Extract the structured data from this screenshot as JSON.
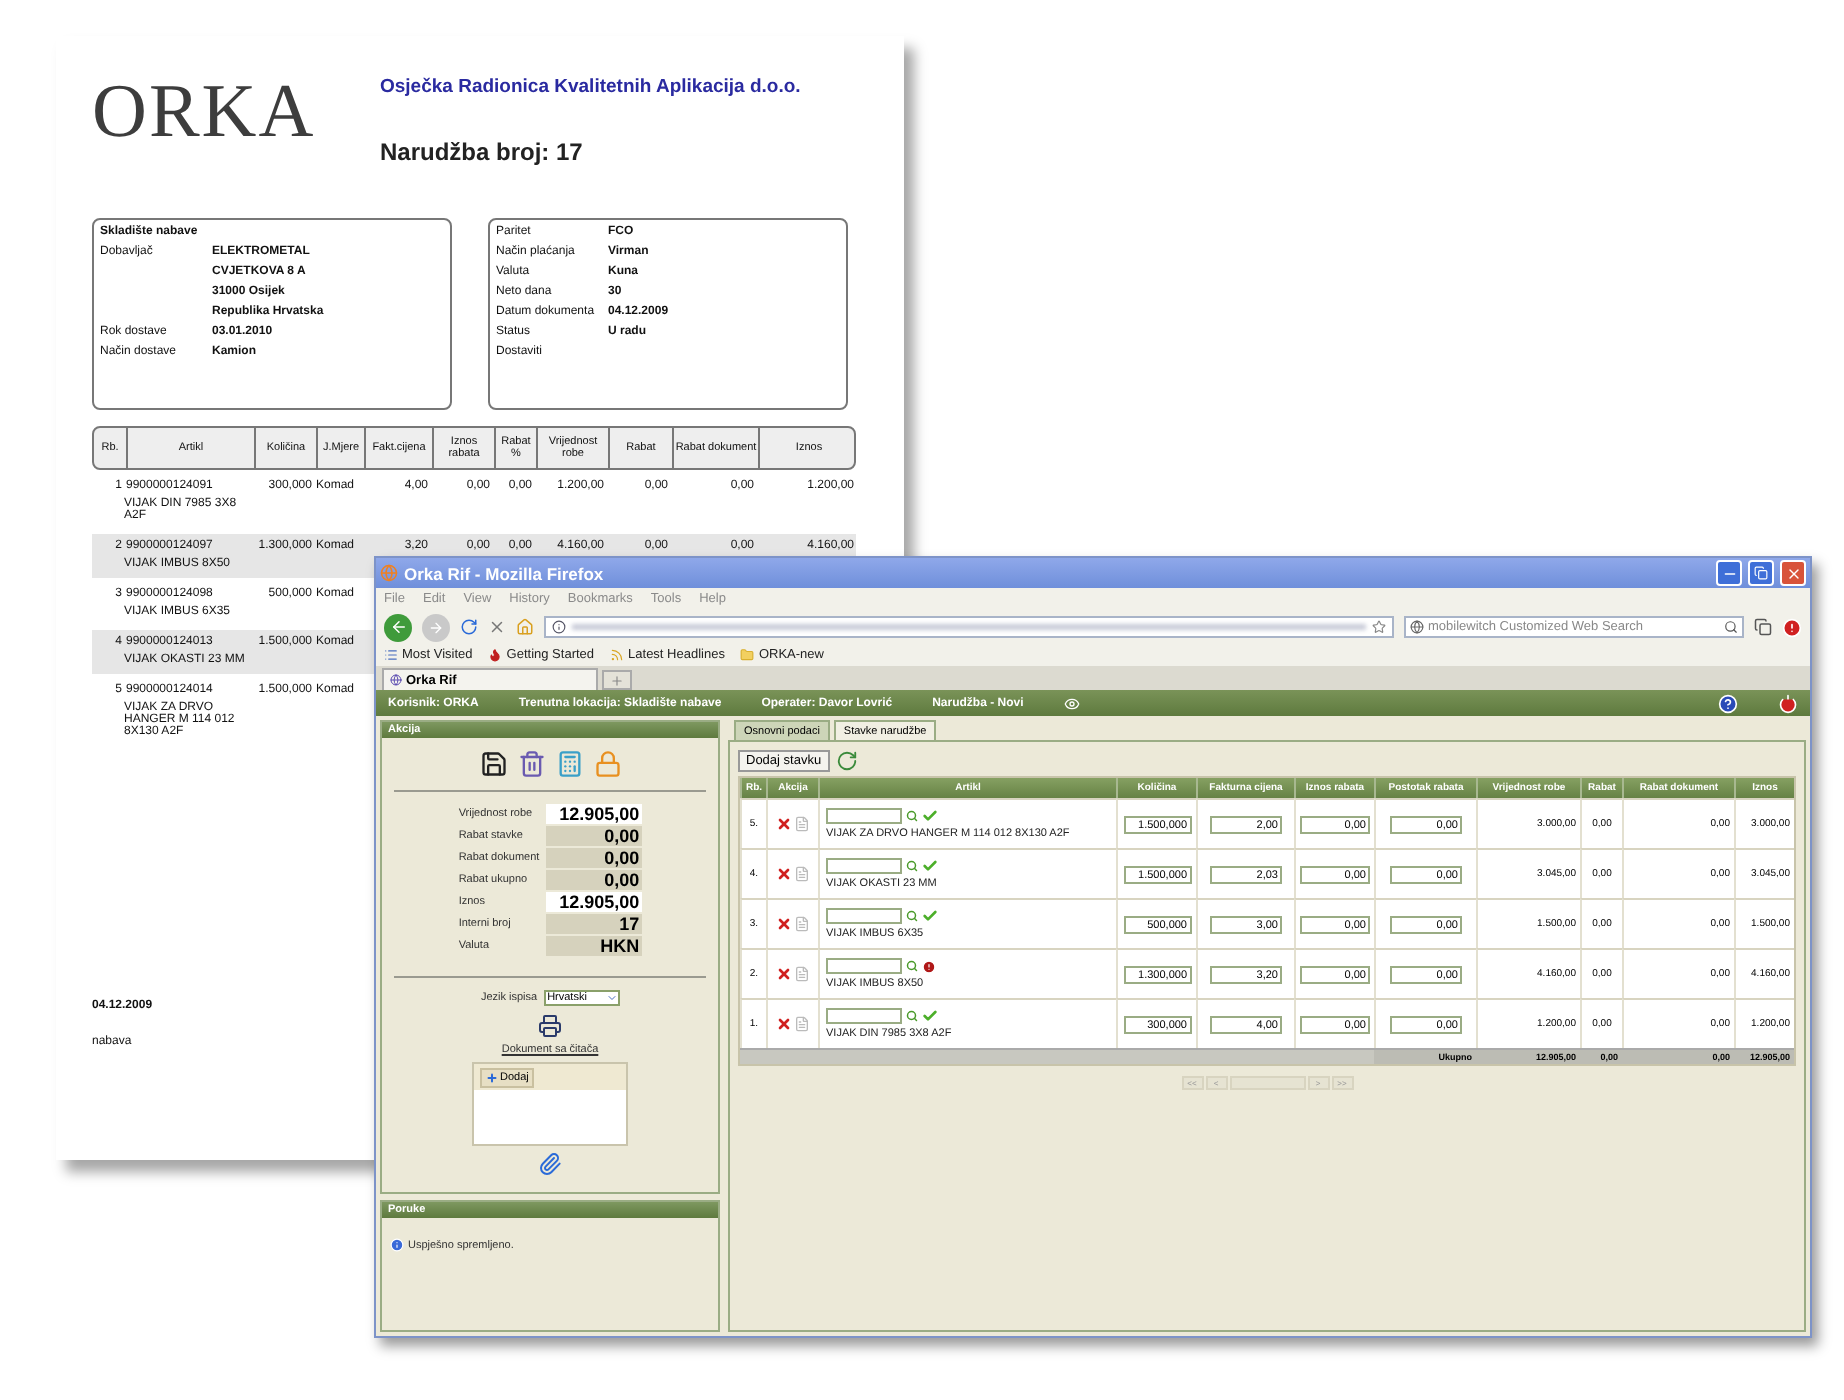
{
  "document": {
    "logo": "ORKA",
    "company": "Osječka Radionica Kvalitetnih Aplikacija d.o.o.",
    "title": "Narudžba broj: 17",
    "left_box": {
      "heading": "Skladište nabave",
      "fields": [
        {
          "label": "Dobavljač",
          "lines": [
            "ELEKTROMETAL",
            "CVJETKOVA 8 A",
            "31000 Osijek",
            "Republika Hrvatska"
          ]
        },
        {
          "label": "Rok dostave",
          "lines": [
            "03.01.2010"
          ]
        },
        {
          "label": "Način dostave",
          "lines": [
            "Kamion"
          ]
        }
      ]
    },
    "right_box": {
      "fields": [
        {
          "label": "Paritet",
          "lines": [
            "FCO"
          ]
        },
        {
          "label": "Način plaćanja",
          "lines": [
            "Virman"
          ]
        },
        {
          "label": "Valuta",
          "lines": [
            "Kuna"
          ]
        },
        {
          "label": "Neto dana",
          "lines": [
            "30"
          ]
        },
        {
          "label": "Datum dokumenta",
          "lines": [
            "04.12.2009"
          ]
        },
        {
          "label": "Status",
          "lines": [
            "U radu"
          ]
        },
        {
          "label": "Dostaviti"
        }
      ]
    },
    "table": {
      "columns": [
        "Rb.",
        "Artikl",
        "Količina",
        "J.Mjere",
        "Fakt.cijena",
        "Iznos rabata",
        "Rabat %",
        "Vrijednost robe",
        "Rabat",
        "Rabat dokument",
        "Iznos"
      ],
      "rows": [
        {
          "shaded": false,
          "name": "VIJAK DIN 7985 3X8 A2F",
          "cells": [
            "1",
            "9900000124091",
            "300,000",
            "Komad",
            "4,00",
            "0,00",
            "0,00",
            "1.200,00",
            "0,00",
            "0,00",
            "1.200,00"
          ]
        },
        {
          "shaded": true,
          "name": "VIJAK IMBUS 8X50",
          "cells": [
            "2",
            "9900000124097",
            "1.300,000",
            "Komad",
            "3,20",
            "0,00",
            "0,00",
            "4.160,00",
            "0,00",
            "0,00",
            "4.160,00"
          ]
        },
        {
          "shaded": false,
          "name": "VIJAK IMBUS 6X35",
          "cells": [
            "3",
            "9900000124098",
            "500,000",
            "Komad"
          ]
        },
        {
          "shaded": true,
          "name": "VIJAK OKASTI 23 MM",
          "cells": [
            "4",
            "9900000124013",
            "1.500,000",
            "Komad"
          ]
        },
        {
          "shaded": false,
          "name": "VIJAK ZA DRVO HANGER M 114 012 8X130 A2F",
          "cells": [
            "5",
            "9900000124014",
            "1.500,000",
            "Komad"
          ]
        }
      ]
    },
    "footer": [
      "04.12.2009",
      "nabava"
    ]
  },
  "window": {
    "title": "Orka Rif - Mozilla Firefox"
  },
  "menu": [
    "File",
    "Edit",
    "View",
    "History",
    "Bookmarks",
    "Tools",
    "Help"
  ],
  "search": {
    "placeholder": "mobilewitch Customized Web Search"
  },
  "bookmarks": [
    {
      "label": "Most Visited",
      "kind": "list"
    },
    {
      "label": "Getting Started",
      "kind": "flame"
    },
    {
      "label": "Latest Headlines",
      "kind": "feed"
    },
    {
      "label": "ORKA-new",
      "kind": "folder"
    }
  ],
  "tabs": [
    {
      "label": "Orka Rif",
      "selected": true
    }
  ],
  "app_bar": [
    "Korisnik: ORKA",
    "Trenutna lokacija: Skladište nabave",
    "Operater: Davor Lovrić",
    "Narudžba - Novi"
  ],
  "akcija": {
    "title": "Akcija",
    "summary": [
      {
        "label": "Vrijednost robe",
        "value": "12.905,00",
        "boxed": false
      },
      {
        "label": "Rabat stavke",
        "value": "0,00",
        "boxed": true
      },
      {
        "label": "Rabat dokument",
        "value": "0,00",
        "boxed": true
      },
      {
        "label": "Rabat ukupno",
        "value": "0,00",
        "boxed": true
      },
      {
        "label": "Iznos",
        "value": "12.905,00",
        "boxed": false
      },
      {
        "label": "Interni broj",
        "value": "17",
        "boxed": true
      },
      {
        "label": "Valuta",
        "value": "HKN",
        "boxed": true
      }
    ],
    "language": {
      "label": "Jezik ispisa",
      "value": "Hrvatski"
    },
    "reader": {
      "title": "Dokument sa čitača",
      "button": "Dodaj"
    }
  },
  "poruke": {
    "title": "Poruke",
    "message": "Uspješno spremljeno."
  },
  "order_tabs": [
    {
      "label": "Osnovni podaci",
      "selected": false
    },
    {
      "label": "Stavke narudžbe",
      "selected": true
    }
  ],
  "add_button": "Dodaj stavku",
  "items_table": {
    "columns": [
      "Rb.",
      "Akcija",
      "Artikl",
      "Količina",
      "Fakturna cijena",
      "Iznos rabata",
      "Postotak rabata",
      "Vrijednost robe",
      "Rabat",
      "Rabat dokument",
      "Iznos"
    ],
    "rows": [
      {
        "rb": "5.",
        "name": "VIJAK ZA DRVO HANGER M 114 012 8X130 A2F",
        "kind": "ok",
        "kolicina": "1.500,000",
        "cijena": "2,00",
        "iznos_rabata": "0,00",
        "postotak_rabata": "0,00",
        "vrijednost": "3.000,00",
        "rabat": "0,00",
        "rabat_dokument": "0,00",
        "iznos": "3.000,00"
      },
      {
        "rb": "4.",
        "name": "VIJAK OKASTI 23 MM",
        "kind": "ok",
        "kolicina": "1.500,000",
        "cijena": "2,03",
        "iznos_rabata": "0,00",
        "postotak_rabata": "0,00",
        "vrijednost": "3.045,00",
        "rabat": "0,00",
        "rabat_dokument": "0,00",
        "iznos": "3.045,00"
      },
      {
        "rb": "3.",
        "name": "VIJAK IMBUS 6X35",
        "kind": "ok",
        "kolicina": "500,000",
        "cijena": "3,00",
        "iznos_rabata": "0,00",
        "postotak_rabata": "0,00",
        "vrijednost": "1.500,00",
        "rabat": "0,00",
        "rabat_dokument": "0,00",
        "iznos": "1.500,00"
      },
      {
        "rb": "2.",
        "name": "VIJAK IMBUS 8X50",
        "kind": "error",
        "kolicina": "1.300,000",
        "cijena": "3,20",
        "iznos_rabata": "0,00",
        "postotak_rabata": "0,00",
        "vrijednost": "4.160,00",
        "rabat": "0,00",
        "rabat_dokument": "0,00",
        "iznos": "4.160,00"
      },
      {
        "rb": "1.",
        "name": "VIJAK DIN 7985 3X8 A2F",
        "kind": "ok",
        "kolicina": "300,000",
        "cijena": "4,00",
        "iznos_rabata": "0,00",
        "postotak_rabata": "0,00",
        "vrijednost": "1.200,00",
        "rabat": "0,00",
        "rabat_dokument": "0,00",
        "iznos": "1.200,00"
      }
    ],
    "totals": {
      "label": "Ukupno",
      "vrijednost": "12.905,00",
      "rabat": "0,00",
      "rabat_dokument": "0,00",
      "iznos": "12.905,00"
    }
  },
  "pager": [
    "<<",
    "<",
    ">",
    ">>"
  ]
}
